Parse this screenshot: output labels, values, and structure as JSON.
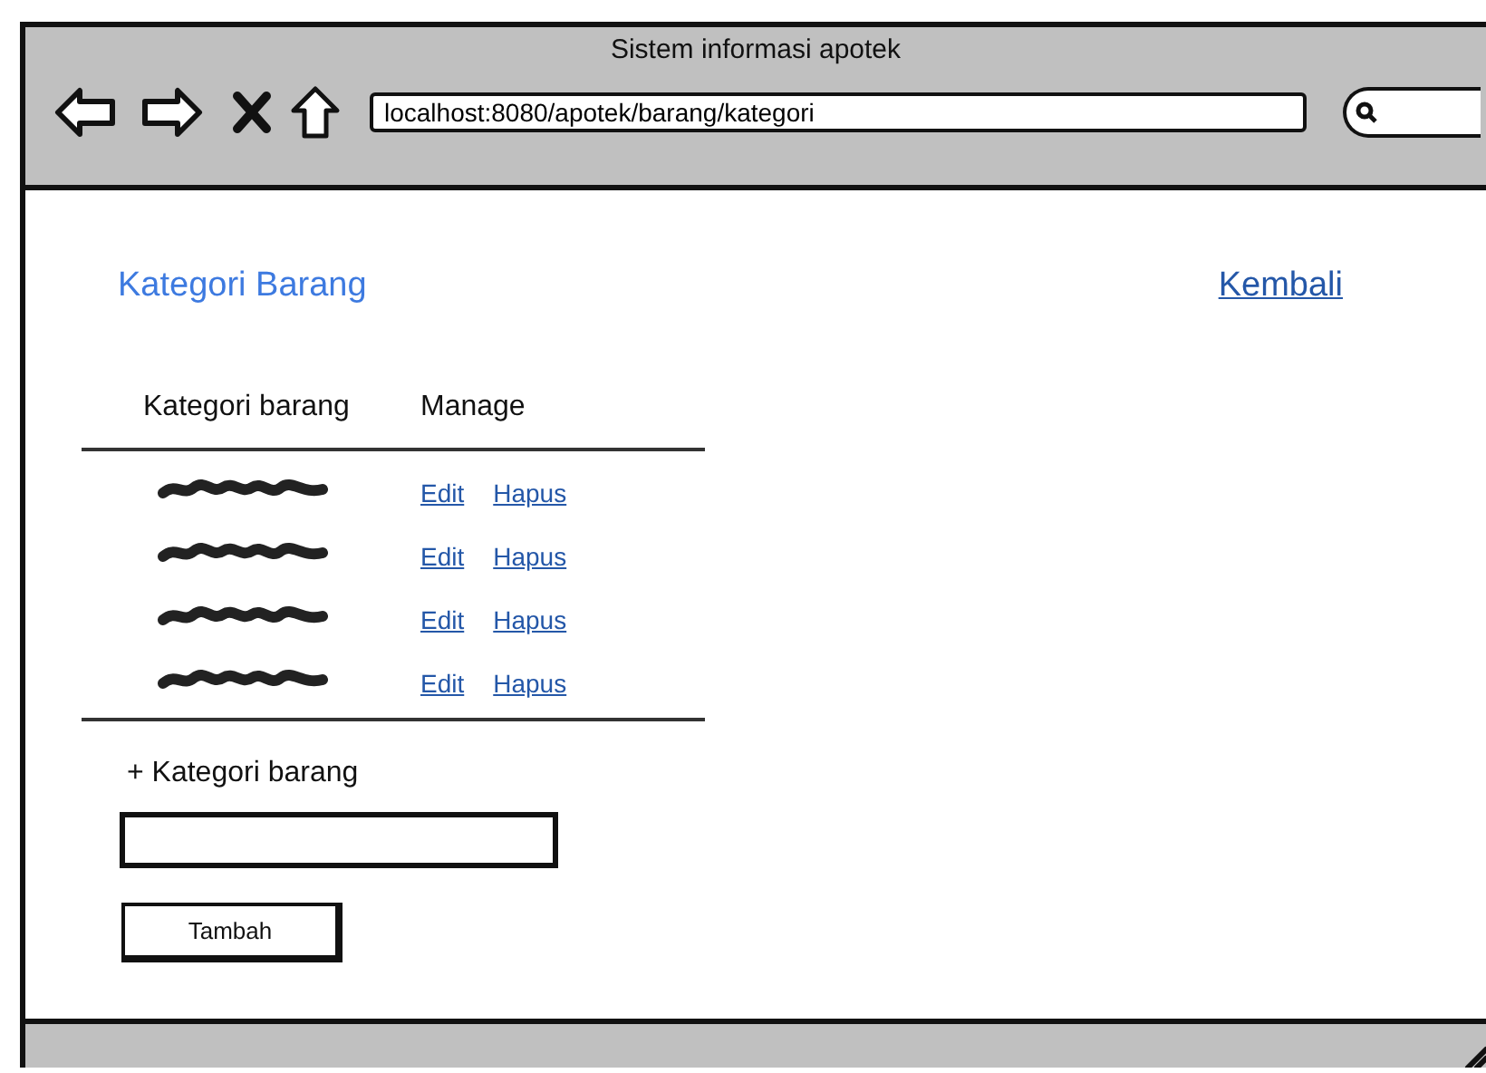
{
  "window": {
    "title": "Sistem informasi apotek",
    "address": "localhost:8080/apotek/barang/kategori"
  },
  "page": {
    "title": "Kategori Barang",
    "back_link": "Kembali"
  },
  "table": {
    "columns": [
      "Kategori barang",
      "Manage"
    ],
    "rows": [
      {
        "edit": "Edit",
        "delete": "Hapus"
      },
      {
        "edit": "Edit",
        "delete": "Hapus"
      },
      {
        "edit": "Edit",
        "delete": "Hapus"
      },
      {
        "edit": "Edit",
        "delete": "Hapus"
      }
    ]
  },
  "form": {
    "label": "+ Kategori barang",
    "button": "Tambah"
  }
}
